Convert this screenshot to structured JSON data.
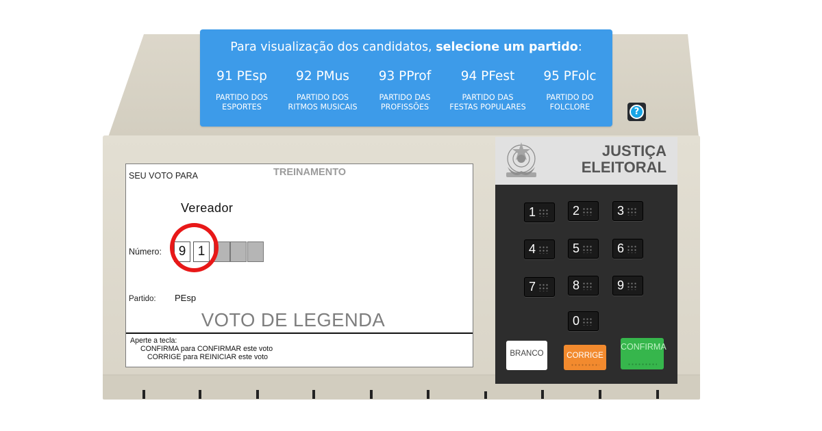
{
  "banner": {
    "title_prefix": "Para visualização dos candidatos, ",
    "title_bold": "selecione um partido",
    "title_suffix": ":",
    "parties": [
      {
        "code": "91 PEsp",
        "name": "PARTIDO DOS\nESPORTES"
      },
      {
        "code": "92 PMus",
        "name": "PARTIDO DOS\nRITMOS MUSICAIS"
      },
      {
        "code": "93 PProf",
        "name": "PARTIDO DAS\nPROFISSÕES"
      },
      {
        "code": "94 PFest",
        "name": "PARTIDO DAS\nFESTAS POPULARES"
      },
      {
        "code": "95 PFolc",
        "name": "PARTIDO DO\nFOLCLORE"
      }
    ],
    "color": "#3d9be9"
  },
  "help": {
    "symbol": "?"
  },
  "screen": {
    "seu_voto_para": "SEU VOTO PARA",
    "mode": "TREINAMENTO",
    "cargo": "Vereador",
    "numero_label": "Número:",
    "digits": [
      "9",
      "1",
      "",
      "",
      ""
    ],
    "partido_label": "Partido:",
    "partido_value": "PEsp",
    "voto_legenda": "VOTO DE LEGENDA",
    "instructions": {
      "line1": "Aperte a tecla:",
      "line2": "CONFIRMA para CONFIRMAR este voto",
      "line3": "CORRIGE para REINICIAR este voto"
    },
    "highlight_color": "#e81818"
  },
  "panel": {
    "brand_line1": "JUSTIÇA",
    "brand_line2": "ELEITORAL",
    "keys": [
      "1",
      "2",
      "3",
      "4",
      "5",
      "6",
      "7",
      "8",
      "9",
      "0"
    ],
    "branco": "BRANCO",
    "corrige": "CORRIGE",
    "confirma": "CONFIRMA",
    "colors": {
      "corrige": "#f28a2e",
      "confirma": "#36b64c",
      "branco": "#ffffff",
      "keypad": "#2d2d2d"
    }
  }
}
